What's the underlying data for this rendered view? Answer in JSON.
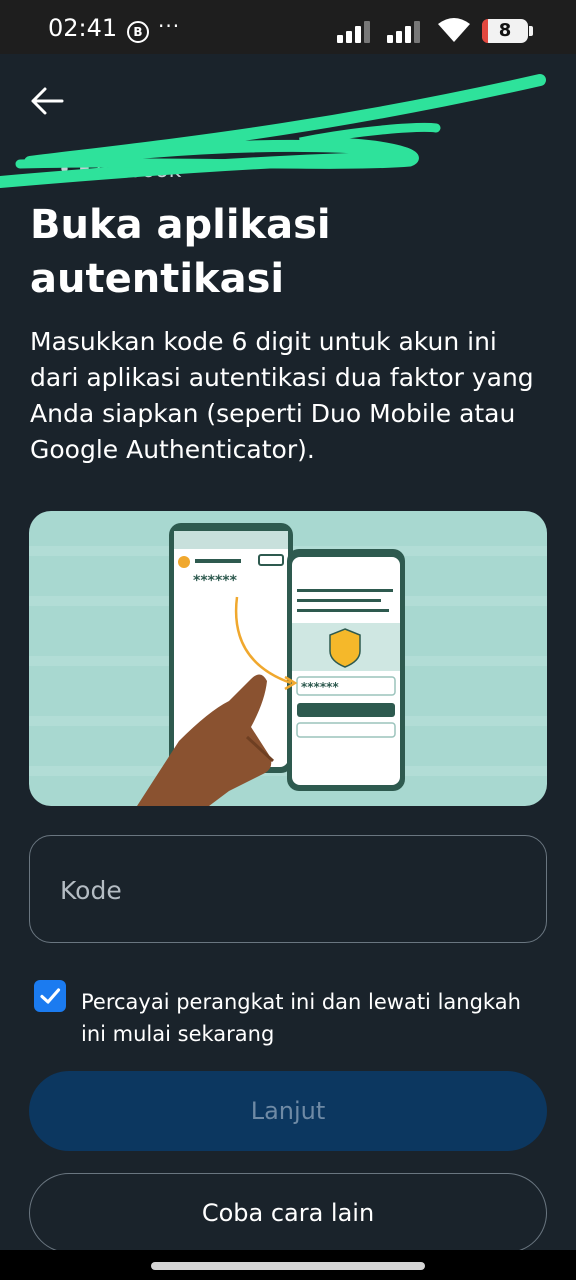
{
  "status_bar": {
    "time": "02:41",
    "b_icon_letter": "B",
    "more": "···",
    "battery_level": "8"
  },
  "header": {
    "account_line": "... • Facebook"
  },
  "page_title": "Buka aplikasi autentikasi",
  "description": "Masukkan kode 6 digit untuk akun ini dari aplikasi autentikasi dua faktor yang Anda siapkan (seperti Duo Mobile atau Google Authenticator).",
  "illustration": {
    "left_phone_code": "******",
    "right_phone_code": "******"
  },
  "code_field": {
    "placeholder": "Kode",
    "value": ""
  },
  "trust_device": {
    "checked": true,
    "label": "Percayai perangkat ini dan lewati langkah ini mulai sekarang"
  },
  "buttons": {
    "continue": "Lanjut",
    "try_another_way": "Coba cara lain"
  },
  "colors": {
    "background": "#1a232b",
    "primary_button": "#0c3760",
    "checkbox": "#1b7bf0",
    "illustration_bg": "#a8d8d0",
    "scribble": "#2ee29b"
  },
  "icons": {
    "back": "arrow-left-icon",
    "check": "checkmark-icon",
    "shield": "shield-icon"
  }
}
